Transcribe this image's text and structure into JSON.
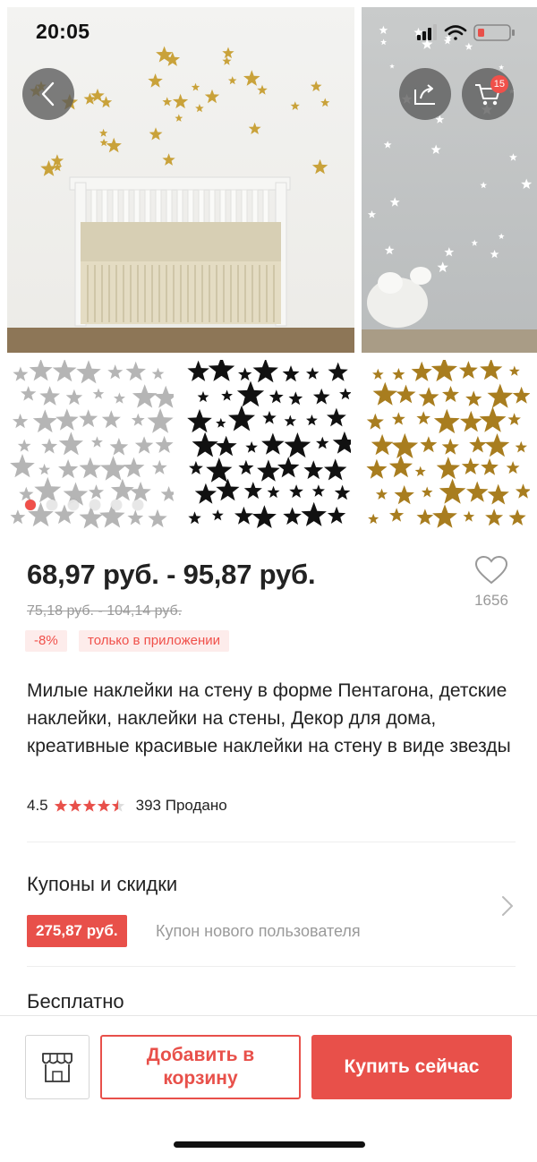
{
  "status": {
    "time": "20:05"
  },
  "header": {
    "cart_count": "15"
  },
  "product": {
    "price_range": "68,97 руб. - 95,87 руб.",
    "old_price_range": "75,18 руб. - 104,14 руб.",
    "discount_tag": "-8%",
    "app_only_tag": "только в приложении",
    "wishlist_count": "1656",
    "title": "Милые наклейки на стену в форме Пентагона, детские наклейки, наклейки на стены, Декор для дома, креативные красивые наклейки на стену в виде звезды",
    "rating": "4.5",
    "rating_value": 4.5,
    "sold": "393 Продано"
  },
  "gallery": {
    "image_count": 6,
    "active_index": 0
  },
  "coupons": {
    "title": "Купоны и скидки",
    "amount": "275,87 руб.",
    "label": "Купон нового пользователя"
  },
  "shipping": {
    "title": "Бесплатно"
  },
  "actions": {
    "add_to_cart_label": "Добавить в корзину",
    "buy_now_label": "Купить сейчас"
  },
  "colors": {
    "accent": "#e8504a",
    "star_gold": "#c9a23a",
    "thumb_gold": "#a87d1f",
    "thumb_grey": "#b5b5b5",
    "thumb_black": "#111111"
  }
}
